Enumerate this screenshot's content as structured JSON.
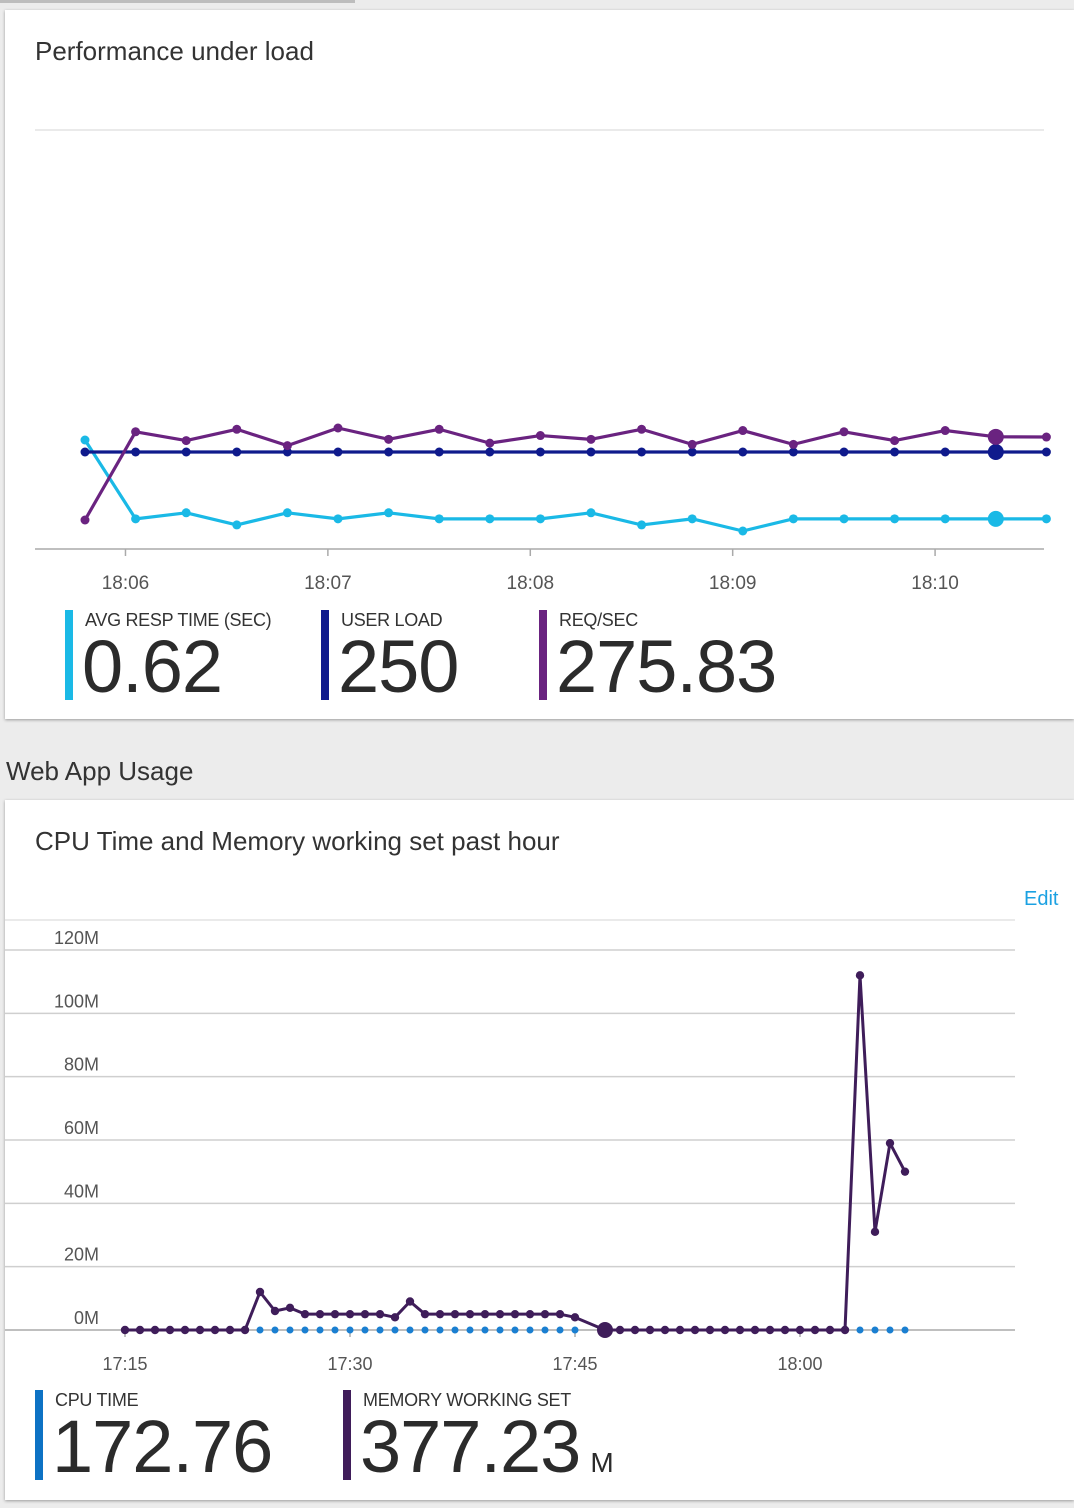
{
  "perf_card": {
    "title": "Performance under load",
    "metrics": [
      {
        "label": "AVG RESP TIME (SEC)",
        "value": "0.62",
        "color": "#1ab9e6"
      },
      {
        "label": "USER LOAD",
        "value": "250",
        "color": "#0f1a8c"
      },
      {
        "label": "REQ/SEC",
        "value": "275.83",
        "color": "#6a2380"
      }
    ]
  },
  "section": {
    "title": "Web App Usage"
  },
  "usage_card": {
    "title": "CPU Time and Memory working set past hour",
    "edit_label": "Edit",
    "metrics": [
      {
        "label": "CPU TIME",
        "value": "172.76",
        "unit": "",
        "color": "#0d72c4"
      },
      {
        "label": "MEMORY WORKING SET",
        "value": "377.23",
        "unit": "M",
        "color": "#3f1d5a"
      }
    ]
  },
  "chart_data": [
    {
      "type": "line",
      "title": "Performance under load",
      "x": [
        "18:05:48",
        "18:06:03",
        "18:06:18",
        "18:06:33",
        "18:06:48",
        "18:07:03",
        "18:07:18",
        "18:07:33",
        "18:07:48",
        "18:08:03",
        "18:08:18",
        "18:08:33",
        "18:08:48",
        "18:09:03",
        "18:09:18",
        "18:09:33",
        "18:09:48",
        "18:10:03",
        "18:10:18",
        "18:10:33"
      ],
      "x_tick_labels": [
        "18:06",
        "18:07",
        "18:08",
        "18:09",
        "18:10"
      ],
      "series": [
        {
          "name": "AVG RESP TIME (SEC)",
          "color": "#1ab9e6",
          "values": [
            0.75,
            0.62,
            0.63,
            0.61,
            0.63,
            0.62,
            0.63,
            0.62,
            0.62,
            0.62,
            0.63,
            0.61,
            0.62,
            0.6,
            0.62,
            0.62,
            0.62,
            0.62,
            0.62,
            0.62
          ]
        },
        {
          "name": "USER LOAD",
          "color": "#0f1a8c",
          "values": [
            250,
            250,
            250,
            250,
            250,
            250,
            250,
            250,
            250,
            250,
            250,
            250,
            250,
            250,
            250,
            250,
            250,
            250,
            250,
            250
          ]
        },
        {
          "name": "REQ/SEC",
          "color": "#6a2380",
          "values": [
            210,
            280,
            273,
            282,
            269,
            283,
            274,
            282,
            271,
            277,
            274,
            282,
            270,
            281,
            270,
            280,
            273,
            281,
            276,
            275.83
          ]
        }
      ]
    },
    {
      "type": "line",
      "title": "CPU Time and Memory working set past hour",
      "y_tick_labels": [
        "0M",
        "20M",
        "40M",
        "60M",
        "80M",
        "100M",
        "120M"
      ],
      "ylim": [
        0,
        120
      ],
      "x_tick_labels": [
        "17:15",
        "17:30",
        "17:45",
        "18:00"
      ],
      "x_minutes_from": "17:15",
      "series": [
        {
          "name": "MEMORY WORKING SET",
          "color": "#3f1d5a",
          "points": [
            [
              0,
              0
            ],
            [
              1,
              0
            ],
            [
              2,
              0
            ],
            [
              3,
              0
            ],
            [
              4,
              0
            ],
            [
              5,
              0
            ],
            [
              6,
              0
            ],
            [
              7,
              0
            ],
            [
              8,
              0
            ],
            [
              9,
              12
            ],
            [
              10,
              6
            ],
            [
              11,
              7
            ],
            [
              12,
              5
            ],
            [
              13,
              5
            ],
            [
              14,
              5
            ],
            [
              15,
              5
            ],
            [
              16,
              5
            ],
            [
              17,
              5
            ],
            [
              18,
              4
            ],
            [
              19,
              9
            ],
            [
              20,
              5
            ],
            [
              21,
              5
            ],
            [
              22,
              5
            ],
            [
              23,
              5
            ],
            [
              24,
              5
            ],
            [
              25,
              5
            ],
            [
              26,
              5
            ],
            [
              27,
              5
            ],
            [
              28,
              5
            ],
            [
              29,
              5
            ],
            [
              30,
              4
            ],
            [
              32,
              0
            ],
            [
              33,
              0
            ],
            [
              34,
              0
            ],
            [
              35,
              0
            ],
            [
              36,
              0
            ],
            [
              37,
              0
            ],
            [
              38,
              0
            ],
            [
              39,
              0
            ],
            [
              40,
              0
            ],
            [
              41,
              0
            ],
            [
              42,
              0
            ],
            [
              43,
              0
            ],
            [
              44,
              0
            ],
            [
              45,
              0
            ],
            [
              46,
              0
            ],
            [
              47,
              0
            ],
            [
              48,
              0
            ],
            [
              49,
              112
            ],
            [
              50,
              31
            ],
            [
              51,
              59
            ],
            [
              52,
              50
            ]
          ]
        },
        {
          "name": "CPU TIME",
          "color": "#1a7fd1",
          "points": [
            [
              9,
              0
            ],
            [
              10,
              0
            ],
            [
              11,
              0
            ],
            [
              12,
              0
            ],
            [
              13,
              0
            ],
            [
              14,
              0
            ],
            [
              15,
              0
            ],
            [
              16,
              0
            ],
            [
              17,
              0
            ],
            [
              18,
              0
            ],
            [
              19,
              0
            ],
            [
              20,
              0
            ],
            [
              21,
              0
            ],
            [
              22,
              0
            ],
            [
              23,
              0
            ],
            [
              24,
              0
            ],
            [
              25,
              0
            ],
            [
              26,
              0
            ],
            [
              27,
              0
            ],
            [
              28,
              0
            ],
            [
              29,
              0
            ],
            [
              30,
              0
            ],
            [
              49,
              0
            ],
            [
              50,
              0
            ],
            [
              51,
              0
            ],
            [
              52,
              0
            ]
          ]
        }
      ]
    }
  ]
}
